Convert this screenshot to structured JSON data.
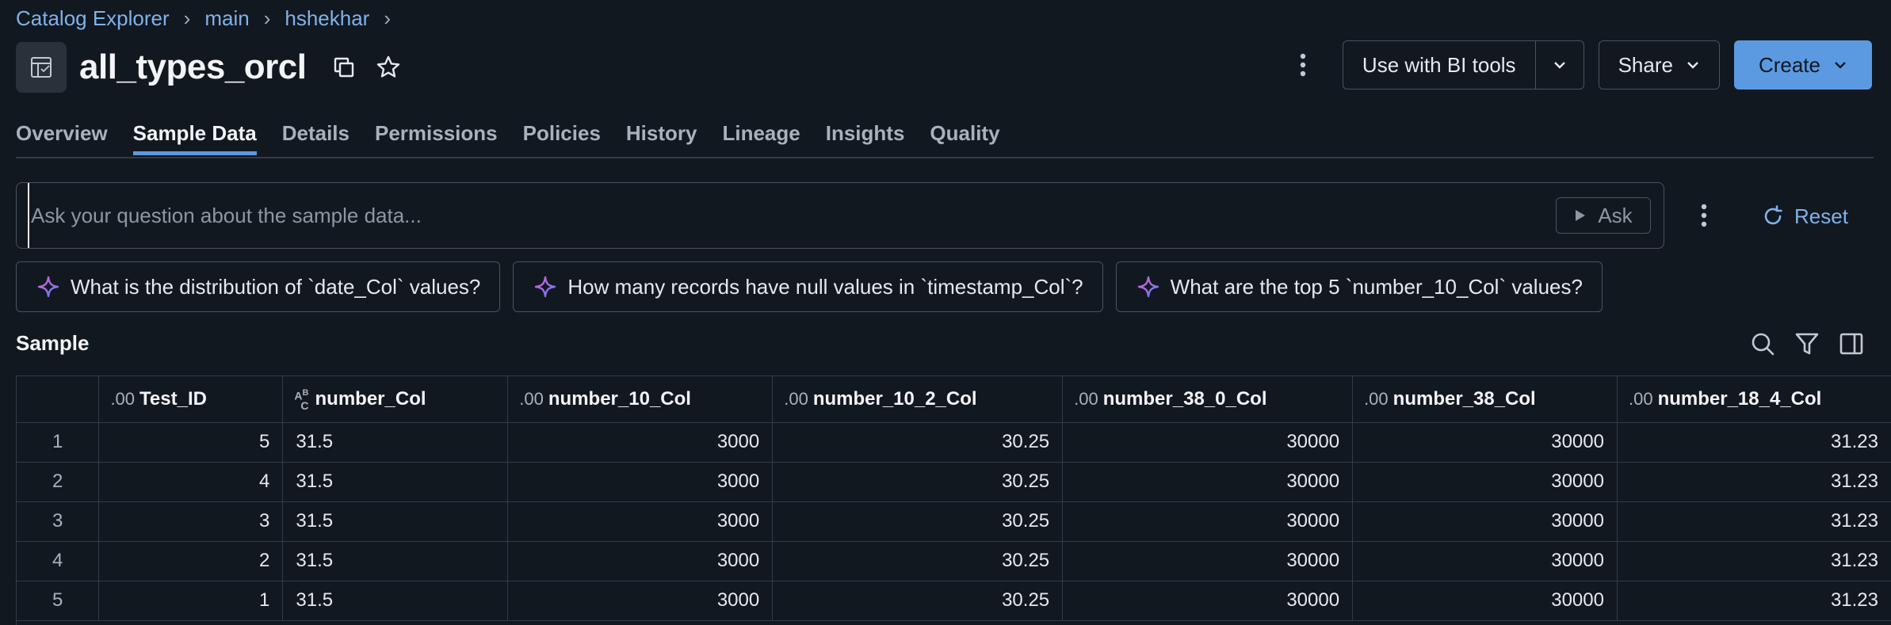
{
  "breadcrumb": {
    "items": [
      "Catalog Explorer",
      "main",
      "hshekhar"
    ],
    "separator": "›"
  },
  "header": {
    "title": "all_types_orcl",
    "bi_tools_label": "Use with BI tools",
    "share_label": "Share",
    "create_label": "Create"
  },
  "tabs": [
    {
      "label": "Overview",
      "active": false
    },
    {
      "label": "Sample Data",
      "active": true
    },
    {
      "label": "Details",
      "active": false
    },
    {
      "label": "Permissions",
      "active": false
    },
    {
      "label": "Policies",
      "active": false
    },
    {
      "label": "History",
      "active": false
    },
    {
      "label": "Lineage",
      "active": false
    },
    {
      "label": "Insights",
      "active": false
    },
    {
      "label": "Quality",
      "active": false
    }
  ],
  "ask": {
    "placeholder": "Ask your question about the sample data...",
    "value": "",
    "ask_label": "Ask",
    "reset_label": "Reset"
  },
  "suggestions": [
    "What is the distribution of `date_Col` values?",
    "How many records have null values in `timestamp_Col`?",
    "What are the top 5 `number_10_Col` values?"
  ],
  "sample": {
    "label": "Sample",
    "columns": [
      {
        "name": "Test_ID",
        "type": ".00"
      },
      {
        "name": "number_Col",
        "type": "ABC"
      },
      {
        "name": "number_10_Col",
        "type": ".00"
      },
      {
        "name": "number_10_2_Col",
        "type": ".00"
      },
      {
        "name": "number_38_0_Col",
        "type": ".00"
      },
      {
        "name": "number_38_Col",
        "type": ".00"
      },
      {
        "name": "number_18_4_Col",
        "type": ".00"
      }
    ],
    "rows": [
      {
        "index": "1",
        "cells": [
          "5",
          "31.5",
          "3000",
          "30.25",
          "30000",
          "30000",
          "31.23"
        ]
      },
      {
        "index": "2",
        "cells": [
          "4",
          "31.5",
          "3000",
          "30.25",
          "30000",
          "30000",
          "31.23"
        ]
      },
      {
        "index": "3",
        "cells": [
          "3",
          "31.5",
          "3000",
          "30.25",
          "30000",
          "30000",
          "31.23"
        ]
      },
      {
        "index": "4",
        "cells": [
          "2",
          "31.5",
          "3000",
          "30.25",
          "30000",
          "30000",
          "31.23"
        ]
      },
      {
        "index": "5",
        "cells": [
          "1",
          "31.5",
          "3000",
          "30.25",
          "30000",
          "30000",
          "31.23"
        ]
      }
    ]
  },
  "colors": {
    "background": "#121820",
    "accent": "#5b9ae0",
    "link": "#7fb2ea",
    "border": "#4a525e",
    "sparkle_start": "#e05bd8",
    "sparkle_end": "#5b7ff0"
  },
  "icons": {
    "table": "table-icon",
    "copy": "copy-icon",
    "favorite": "star-icon",
    "more": "kebab-icon",
    "play": "play-icon",
    "reset": "refresh-icon",
    "sparkle": "sparkle-icon",
    "search": "search-icon",
    "filter": "filter-icon",
    "panel": "side-panel-icon"
  }
}
